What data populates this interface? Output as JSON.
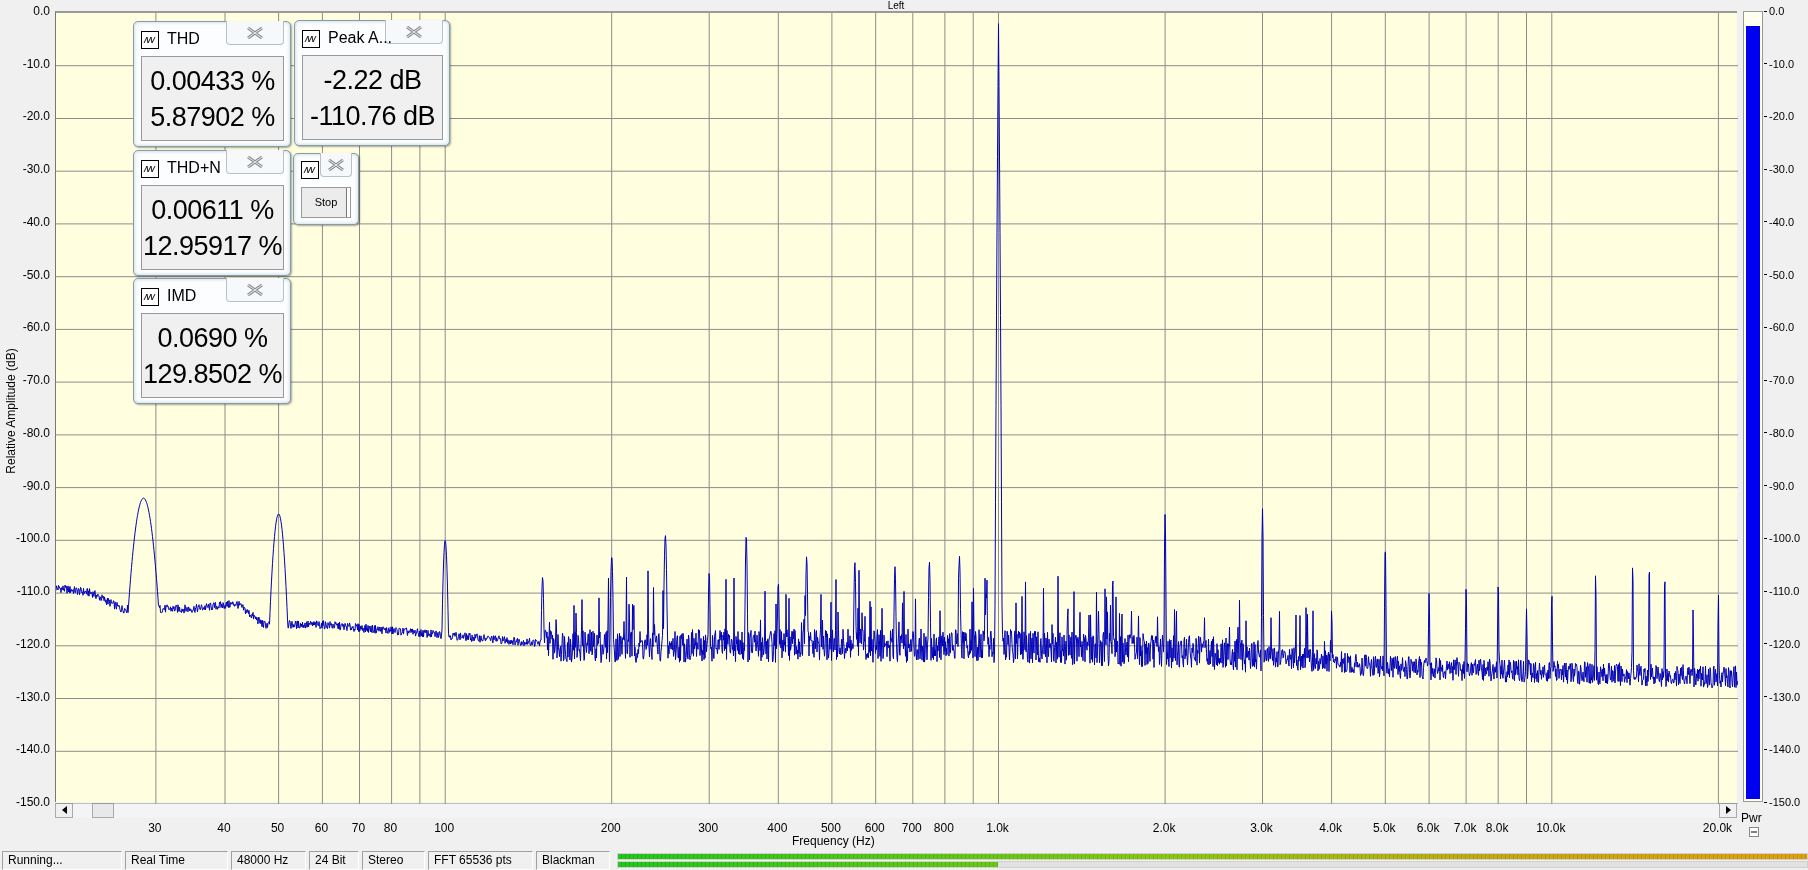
{
  "chart": {
    "title": "Left",
    "ylabel": "Relative Amplitude (dB)",
    "xlabel": "Frequency (Hz)",
    "yticks": [
      "0.0",
      "-10.0",
      "-20.0",
      "-30.0",
      "-40.0",
      "-50.0",
      "-60.0",
      "-70.0",
      "-80.0",
      "-90.0",
      "-100.0",
      "-110.0",
      "-120.0",
      "-130.0",
      "-140.0",
      "-150.0"
    ],
    "xticks": [
      "30",
      "40",
      "50",
      "60",
      "70",
      "80",
      "100",
      "200",
      "300",
      "400",
      "500",
      "600",
      "700",
      "800",
      "1.0k",
      "2.0k",
      "3.0k",
      "4.0k",
      "5.0k",
      "6.0k",
      "7.0k",
      "8.0k",
      "10.0k",
      "20.0k"
    ]
  },
  "panels": [
    {
      "kind": "readout",
      "title": "THD",
      "values": [
        "0.00433 %",
        "5.87902 %"
      ]
    },
    {
      "kind": "readout",
      "title": "Peak A...",
      "values": [
        "-2.22 dB",
        "-110.76 dB"
      ]
    },
    {
      "kind": "readout",
      "title": "THD+N",
      "values": [
        "0.00611 %",
        "12.95917 %"
      ]
    },
    {
      "kind": "control",
      "button": "Stop"
    },
    {
      "kind": "readout",
      "title": "IMD",
      "values": [
        "0.0690 %",
        "129.8502 %"
      ]
    }
  ],
  "power_meter": {
    "label": "Pwr",
    "level": 0.985,
    "ticks": [
      "0.0",
      "-10.0",
      "-20.0",
      "-30.0",
      "-40.0",
      "-50.0",
      "-60.0",
      "-70.0",
      "-80.0",
      "-90.0",
      "-100.0",
      "-110.0",
      "-120.0",
      "-130.0",
      "-140.0",
      "-150.0"
    ]
  },
  "status_bar": {
    "fields": [
      "Running...",
      "Real Time",
      "48000 Hz",
      "24 Bit",
      "Stereo",
      "FFT 65536 pts",
      "Blackman"
    ],
    "levels": [
      {
        "level": 1.0
      },
      {
        "level": 0.32
      }
    ]
  }
}
